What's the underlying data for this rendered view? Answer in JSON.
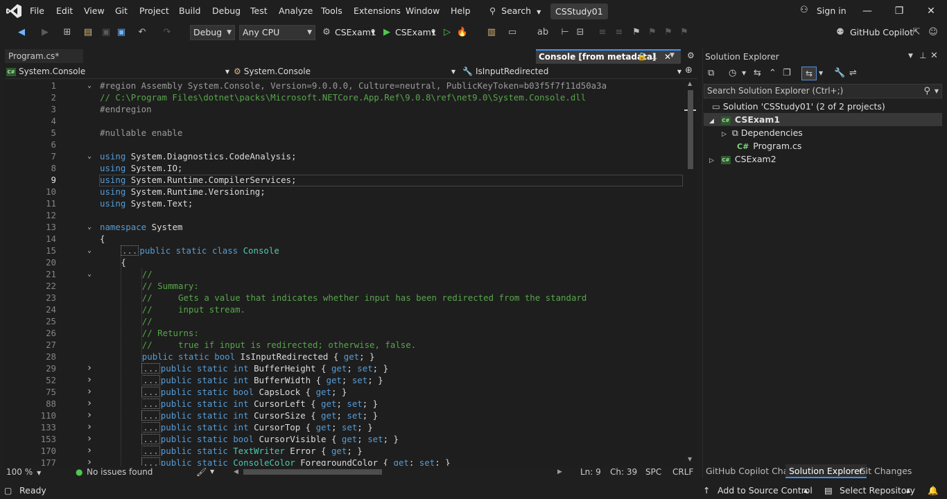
{
  "menu": {
    "items": [
      "File",
      "Edit",
      "View",
      "Git",
      "Project",
      "Build",
      "Debug",
      "Test",
      "Analyze",
      "Tools",
      "Extensions",
      "Window",
      "Help"
    ],
    "search_label": "Search",
    "solution_name": "CSStudy01",
    "signin_label": "Sign in"
  },
  "toolbar": {
    "config": "Debug",
    "platform": "Any CPU",
    "startup_project": "CSExam1",
    "run_target": "CSExam1",
    "copilot_label": "GitHub Copilot"
  },
  "tabs": {
    "file_tab": "Program.cs*",
    "metadata_tab": "Console [from metadata]"
  },
  "navbar": {
    "project": "System.Console",
    "type": "System.Console",
    "member": "IsInputRedirected"
  },
  "editor": {
    "lines": [
      {
        "n": "1",
        "fold": "v",
        "indent": 0,
        "segs": [
          [
            "pp",
            "#region Assembly System.Console, Version=9.0.0.0, Culture=neutral, PublicKeyToken=b03f5f7f11d50a3a"
          ]
        ]
      },
      {
        "n": "2",
        "fold": "",
        "indent": 0,
        "segs": [
          [
            "cm",
            "// C:\\Program Files\\dotnet\\packs\\Microsoft.NETCore.App.Ref\\9.0.8\\ref\\net9.0\\System.Console.dll"
          ]
        ]
      },
      {
        "n": "3",
        "fold": "",
        "indent": 0,
        "segs": [
          [
            "pp",
            "#endregion"
          ]
        ]
      },
      {
        "n": "4",
        "fold": "",
        "indent": 0,
        "segs": []
      },
      {
        "n": "5",
        "fold": "",
        "indent": 0,
        "segs": [
          [
            "pp",
            "#nullable enable"
          ]
        ]
      },
      {
        "n": "6",
        "fold": "",
        "indent": 0,
        "segs": []
      },
      {
        "n": "7",
        "fold": "v",
        "indent": 0,
        "segs": [
          [
            "kw",
            "using "
          ],
          [
            "tx",
            "System.Diagnostics.CodeAnalysis;"
          ]
        ]
      },
      {
        "n": "8",
        "fold": "",
        "indent": 0,
        "segs": [
          [
            "kw",
            "using "
          ],
          [
            "tx",
            "System.IO;"
          ]
        ]
      },
      {
        "n": "9",
        "fold": "",
        "indent": 0,
        "segs": [
          [
            "kw",
            "using "
          ],
          [
            "tx",
            "System.Runtime.CompilerServices;"
          ]
        ]
      },
      {
        "n": "10",
        "fold": "",
        "indent": 0,
        "segs": [
          [
            "kw",
            "using "
          ],
          [
            "tx",
            "System.Runtime.Versioning;"
          ]
        ]
      },
      {
        "n": "11",
        "fold": "",
        "indent": 0,
        "segs": [
          [
            "kw",
            "using "
          ],
          [
            "tx",
            "System.Text;"
          ]
        ]
      },
      {
        "n": "12",
        "fold": "",
        "indent": 0,
        "segs": []
      },
      {
        "n": "13",
        "fold": "v",
        "indent": 0,
        "segs": [
          [
            "kw",
            "namespace "
          ],
          [
            "tx",
            "System"
          ]
        ]
      },
      {
        "n": "14",
        "fold": "",
        "indent": 0,
        "segs": [
          [
            "tx",
            "{"
          ]
        ]
      },
      {
        "n": "15",
        "fold": "v",
        "indent": 4,
        "dots": true,
        "segs": [
          [
            "kw",
            "public static class "
          ],
          [
            "ty",
            "Console"
          ]
        ]
      },
      {
        "n": "20",
        "fold": "",
        "indent": 4,
        "segs": [
          [
            "tx",
            "{"
          ]
        ]
      },
      {
        "n": "21",
        "fold": "v",
        "indent": 8,
        "segs": [
          [
            "cm",
            "//"
          ]
        ]
      },
      {
        "n": "22",
        "fold": "",
        "indent": 8,
        "segs": [
          [
            "cm",
            "// Summary:"
          ]
        ]
      },
      {
        "n": "23",
        "fold": "",
        "indent": 8,
        "segs": [
          [
            "cm",
            "//     Gets a value that indicates whether input has been redirected from the standard"
          ]
        ]
      },
      {
        "n": "24",
        "fold": "",
        "indent": 8,
        "segs": [
          [
            "cm",
            "//     input stream."
          ]
        ]
      },
      {
        "n": "25",
        "fold": "",
        "indent": 8,
        "segs": [
          [
            "cm",
            "//"
          ]
        ]
      },
      {
        "n": "26",
        "fold": "",
        "indent": 8,
        "segs": [
          [
            "cm",
            "// Returns:"
          ]
        ]
      },
      {
        "n": "27",
        "fold": "",
        "indent": 8,
        "segs": [
          [
            "cm",
            "//     true if input is redirected; otherwise, false."
          ]
        ]
      },
      {
        "n": "28",
        "fold": "",
        "indent": 8,
        "segs": [
          [
            "kw",
            "public static bool "
          ],
          [
            "tx",
            "IsInputRedirected { "
          ],
          [
            "kw",
            "get"
          ],
          [
            "tx",
            "; }"
          ]
        ]
      },
      {
        "n": "29",
        "fold": ">",
        "indent": 8,
        "dots": true,
        "segs": [
          [
            "kw",
            "public static int "
          ],
          [
            "tx",
            "BufferHeight { "
          ],
          [
            "kw",
            "get"
          ],
          [
            "tx",
            "; "
          ],
          [
            "kw",
            "set"
          ],
          [
            "tx",
            "; }"
          ]
        ]
      },
      {
        "n": "52",
        "fold": ">",
        "indent": 8,
        "dots": true,
        "segs": [
          [
            "kw",
            "public static int "
          ],
          [
            "tx",
            "BufferWidth { "
          ],
          [
            "kw",
            "get"
          ],
          [
            "tx",
            "; "
          ],
          [
            "kw",
            "set"
          ],
          [
            "tx",
            "; }"
          ]
        ]
      },
      {
        "n": "75",
        "fold": ">",
        "indent": 8,
        "dots": true,
        "segs": [
          [
            "kw",
            "public static bool "
          ],
          [
            "tx",
            "CapsLock { "
          ],
          [
            "kw",
            "get"
          ],
          [
            "tx",
            "; }"
          ]
        ]
      },
      {
        "n": "88",
        "fold": ">",
        "indent": 8,
        "dots": true,
        "segs": [
          [
            "kw",
            "public static int "
          ],
          [
            "tx",
            "CursorLeft { "
          ],
          [
            "kw",
            "get"
          ],
          [
            "tx",
            "; "
          ],
          [
            "kw",
            "set"
          ],
          [
            "tx",
            "; }"
          ]
        ]
      },
      {
        "n": "110",
        "fold": ">",
        "indent": 8,
        "dots": true,
        "segs": [
          [
            "kw",
            "public static int "
          ],
          [
            "tx",
            "CursorSize { "
          ],
          [
            "kw",
            "get"
          ],
          [
            "tx",
            "; "
          ],
          [
            "kw",
            "set"
          ],
          [
            "tx",
            "; }"
          ]
        ]
      },
      {
        "n": "133",
        "fold": ">",
        "indent": 8,
        "dots": true,
        "segs": [
          [
            "kw",
            "public static int "
          ],
          [
            "tx",
            "CursorTop { "
          ],
          [
            "kw",
            "get"
          ],
          [
            "tx",
            "; "
          ],
          [
            "kw",
            "set"
          ],
          [
            "tx",
            "; }"
          ]
        ]
      },
      {
        "n": "153",
        "fold": ">",
        "indent": 8,
        "dots": true,
        "segs": [
          [
            "kw",
            "public static bool "
          ],
          [
            "tx",
            "CursorVisible { "
          ],
          [
            "kw",
            "get"
          ],
          [
            "tx",
            "; "
          ],
          [
            "kw",
            "set"
          ],
          [
            "tx",
            "; }"
          ]
        ]
      },
      {
        "n": "170",
        "fold": ">",
        "indent": 8,
        "dots": true,
        "segs": [
          [
            "kw",
            "public static "
          ],
          [
            "ty",
            "TextWriter "
          ],
          [
            "tx",
            "Error { "
          ],
          [
            "kw",
            "get"
          ],
          [
            "tx",
            "; }"
          ]
        ]
      },
      {
        "n": "177",
        "fold": ">",
        "indent": 8,
        "dots": true,
        "segs": [
          [
            "kw",
            "public static "
          ],
          [
            "ty",
            "ConsoleColor "
          ],
          [
            "tx",
            "ForegroundColor { "
          ],
          [
            "kw",
            "get"
          ],
          [
            "tx",
            "; "
          ],
          [
            "kw",
            "set"
          ],
          [
            "tx",
            "; }"
          ]
        ]
      }
    ],
    "dots_text": "..."
  },
  "editor_status": {
    "zoom": "100 %",
    "issues": "No issues found",
    "line": "Ln: 9",
    "col": "Ch: 39",
    "whitespace": "SPC",
    "line_endings": "CRLF"
  },
  "solution_explorer": {
    "title": "Solution Explorer",
    "search_placeholder": "Search Solution Explorer (Ctrl+;)",
    "solution_label": "Solution 'CSStudy01' (2 of 2 projects)",
    "project1": "CSExam1",
    "dependencies": "Dependencies",
    "file": "Program.cs",
    "project2": "CSExam2",
    "cs_badge": "C#",
    "tabs": [
      "GitHub Copilot Chat",
      "Solution Explorer",
      "Git Changes"
    ]
  },
  "statusbar": {
    "ready": "Ready",
    "add_source": "Add to Source Control",
    "select_repo": "Select Repository"
  }
}
